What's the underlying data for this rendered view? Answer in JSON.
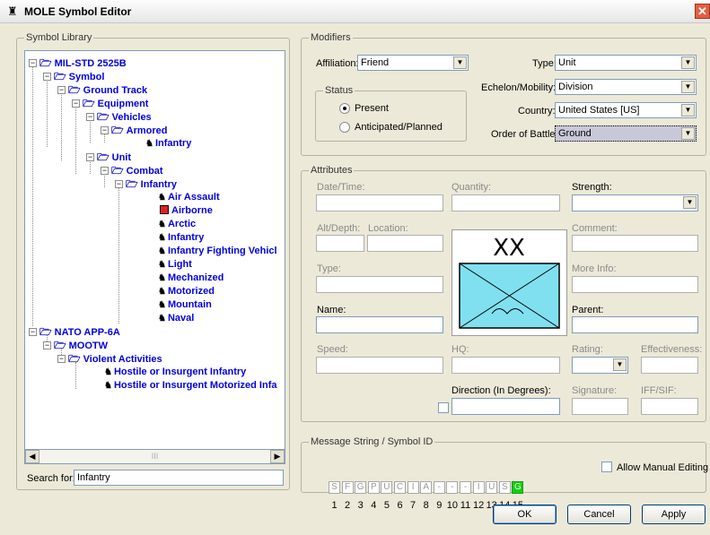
{
  "window": {
    "title": "MOLE Symbol Editor",
    "close": "✕"
  },
  "library": {
    "group_label": "Symbol Library",
    "tree": [
      "MIL-STD 2525B",
      "Symbol",
      "Ground Track",
      "Equipment",
      "Vehicles",
      "Armored",
      "Infantry",
      "Unit",
      "Combat",
      "Infantry",
      "Air Assault",
      "Airborne",
      "Arctic",
      "Infantry",
      "Infantry Fighting Vehicl",
      "Light",
      "Mechanized",
      "Motorized",
      "Mountain",
      "Naval",
      "NATO APP-6A",
      "MOOTW",
      "Violent Activities",
      "Hostile or Insurgent Infantry",
      "Hostile or Insurgent Motorized Infa"
    ],
    "scroll_mid": "III",
    "search_label": "Search for:",
    "search_value": "Infantry"
  },
  "modifiers": {
    "group_label": "Modifiers",
    "affiliation_label": "Affiliation:",
    "affiliation": "Friend",
    "type_label": "Type:",
    "type": "Unit",
    "echelon_label": "Echelon/Mobility:",
    "echelon": "Division",
    "country_label": "Country:",
    "country": "United States [US]",
    "order_label": "Order of Battle:",
    "order": "Ground",
    "status_label": "Status",
    "status_present": "Present",
    "status_planned": "Anticipated/Planned"
  },
  "attributes": {
    "group_label": "Attributes",
    "date_time": "Date/Time:",
    "quantity": "Quantity:",
    "strength": "Strength:",
    "alt_depth": "Alt/Depth:",
    "location": "Location:",
    "comment": "Comment:",
    "type": "Type:",
    "more_info": "More Info:",
    "name": "Name:",
    "parent": "Parent:",
    "speed": "Speed:",
    "hq": "HQ:",
    "rating": "Rating:",
    "effectiveness": "Effectiveness:",
    "direction": "Direction (In Degrees):",
    "signature": "Signature:",
    "iff_sif": "IFF/SIF:",
    "echelon_mark": "XX"
  },
  "message": {
    "group_label": "Message String / Symbol ID",
    "cells": [
      "S",
      "F",
      "G",
      "P",
      "U",
      "C",
      "I",
      "A",
      "-",
      "-",
      "-",
      "I",
      "U",
      "S",
      "G"
    ],
    "numbers": [
      "1",
      "2",
      "3",
      "4",
      "5",
      "6",
      "7",
      "8",
      "9",
      "10",
      "11",
      "12",
      "13",
      "14",
      "15"
    ],
    "manual_label": "Allow Manual Editing"
  },
  "buttons": {
    "ok": "OK",
    "cancel": "Cancel",
    "apply": "Apply"
  }
}
